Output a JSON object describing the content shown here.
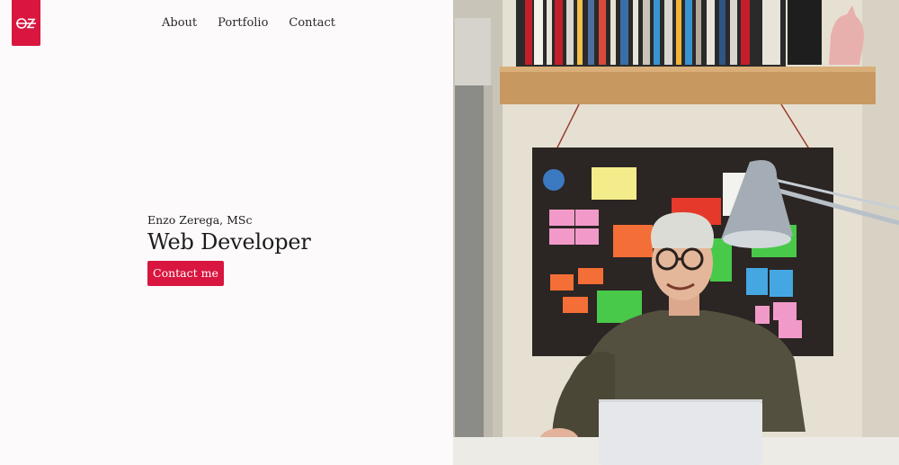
{
  "logo": {
    "text": "ØZ",
    "color": "#d9163f"
  },
  "nav": {
    "items": [
      "About",
      "Portfolio",
      "Contact"
    ]
  },
  "hero": {
    "subtitle": "Enzo Zerega, MSc",
    "title": "Web Developer",
    "cta_label": "Contact me"
  },
  "colors": {
    "accent": "#d9163f",
    "background": "#fdfafb"
  },
  "photo": {
    "icon": "portrait-photo"
  }
}
